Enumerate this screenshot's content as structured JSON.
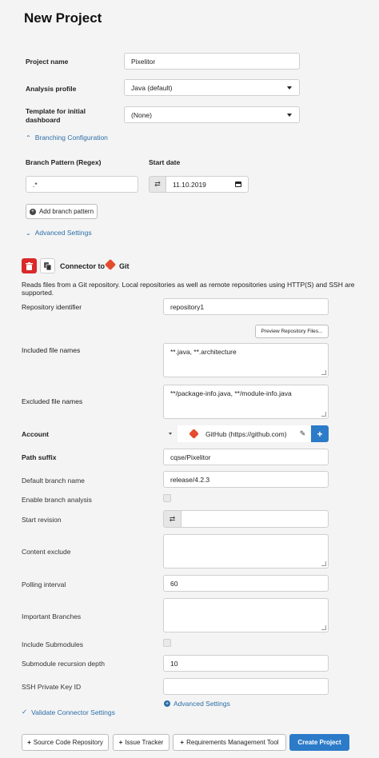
{
  "page_title": "New Project",
  "form": {
    "project_name_label": "Project name",
    "project_name_value": "Pixelitor",
    "analysis_profile_label": "Analysis profile",
    "analysis_profile_value": "Java (default)",
    "template_label_line1": "Template for initial",
    "template_label_line2": "dashboard",
    "template_value": "(None)",
    "branching_config_link": "Branching Configuration",
    "branch_pattern_label": "Branch Pattern (Regex)",
    "branch_pattern_value": ".*",
    "start_date_label": "Start date",
    "start_date_value": "11.10.2019",
    "add_branch_pattern": "Add branch pattern",
    "advanced_settings_link": "Advanced Settings"
  },
  "connector": {
    "title": "Connector to",
    "git_label": "Git",
    "description": "Reads files from a Git repository. Local repositories as well as remote repositories using HTTP(S) and SSH are supported.",
    "repo_id_label": "Repository identifier",
    "repo_id_value": "repository1",
    "preview_button": "Preview Repository Files...",
    "included_label": "Included file names",
    "included_value": "**.java, **.architecture",
    "excluded_label": "Excluded file names",
    "excluded_value": "**/package-info.java, **/module-info.java",
    "account_label": "Account",
    "account_value": "GitHub (https://github.com)",
    "path_suffix_label": "Path suffix",
    "path_suffix_value": "cqse/Pixelitor",
    "default_branch_label": "Default branch name",
    "default_branch_value": "release/4.2.3",
    "enable_branch_label": "Enable branch analysis",
    "start_revision_label": "Start revision",
    "content_exclude_label": "Content exclude",
    "polling_label": "Polling interval",
    "polling_value": "60",
    "important_branches_label": "Important Branches",
    "include_submodules_label": "Include Submodules",
    "submodule_depth_label": "Submodule recursion depth",
    "submodule_depth_value": "10",
    "ssh_key_label": "SSH Private Key ID",
    "advanced_settings_link": "Advanced Settings",
    "validate_link": "Validate Connector Settings"
  },
  "footer": {
    "source_code_repo": "Source Code Repository",
    "issue_tracker": "Issue Tracker",
    "requirements_tool": "Requirements Management Tool",
    "create_project": "Create Project"
  },
  "colors": {
    "primary": "#2c7bc9",
    "danger": "#db2828",
    "link": "#2c6ea8",
    "git": "#e44c30"
  }
}
